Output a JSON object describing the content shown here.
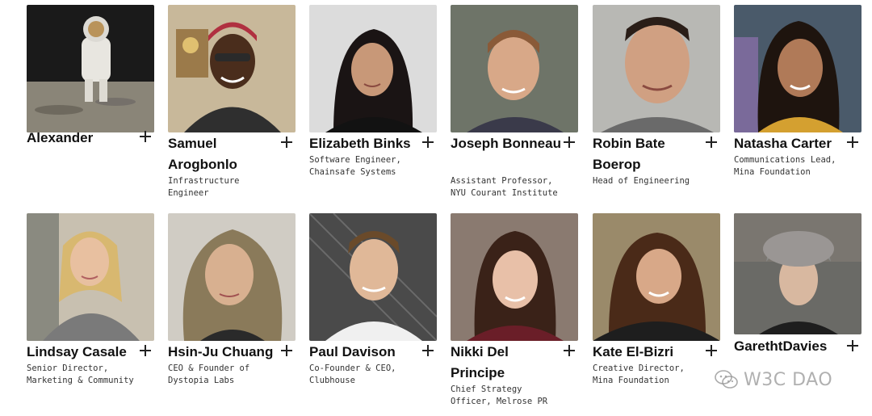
{
  "people": [
    {
      "name": "Alexander",
      "role": ""
    },
    {
      "name": "Samuel Arogbonlo",
      "role": "Infrastructure Engineer"
    },
    {
      "name": "Elizabeth Binks",
      "role": "Software Engineer, Chainsafe Systems"
    },
    {
      "name": "Joseph Bonneau",
      "role": "Assistant Professor, NYU Courant Institute"
    },
    {
      "name": "Robin Bate Boerop",
      "role": "Head of Engineering"
    },
    {
      "name": "Natasha Carter",
      "role": "Communications Lead, Mina Foundation"
    },
    {
      "name": "Lindsay Casale",
      "role": "Senior Director, Marketing & Community"
    },
    {
      "name": "Hsin-Ju Chuang",
      "role": "CEO & Founder of Dystopia Labs"
    },
    {
      "name": "Paul Davison",
      "role": "Co-Founder & CEO, Clubhouse"
    },
    {
      "name": "Nikki Del Principe",
      "role": "Chief Strategy Officer, Melrose PR"
    },
    {
      "name": "Kate El-Bizri",
      "role": "Creative Director, Mina Foundation"
    },
    {
      "name": "GarethtDavies",
      "role": ""
    }
  ],
  "watermark": {
    "text": "W3C DAO",
    "icon": "wechat-icon"
  },
  "colors": {
    "text": "#111111",
    "role_text": "#333333",
    "background": "#ffffff"
  }
}
